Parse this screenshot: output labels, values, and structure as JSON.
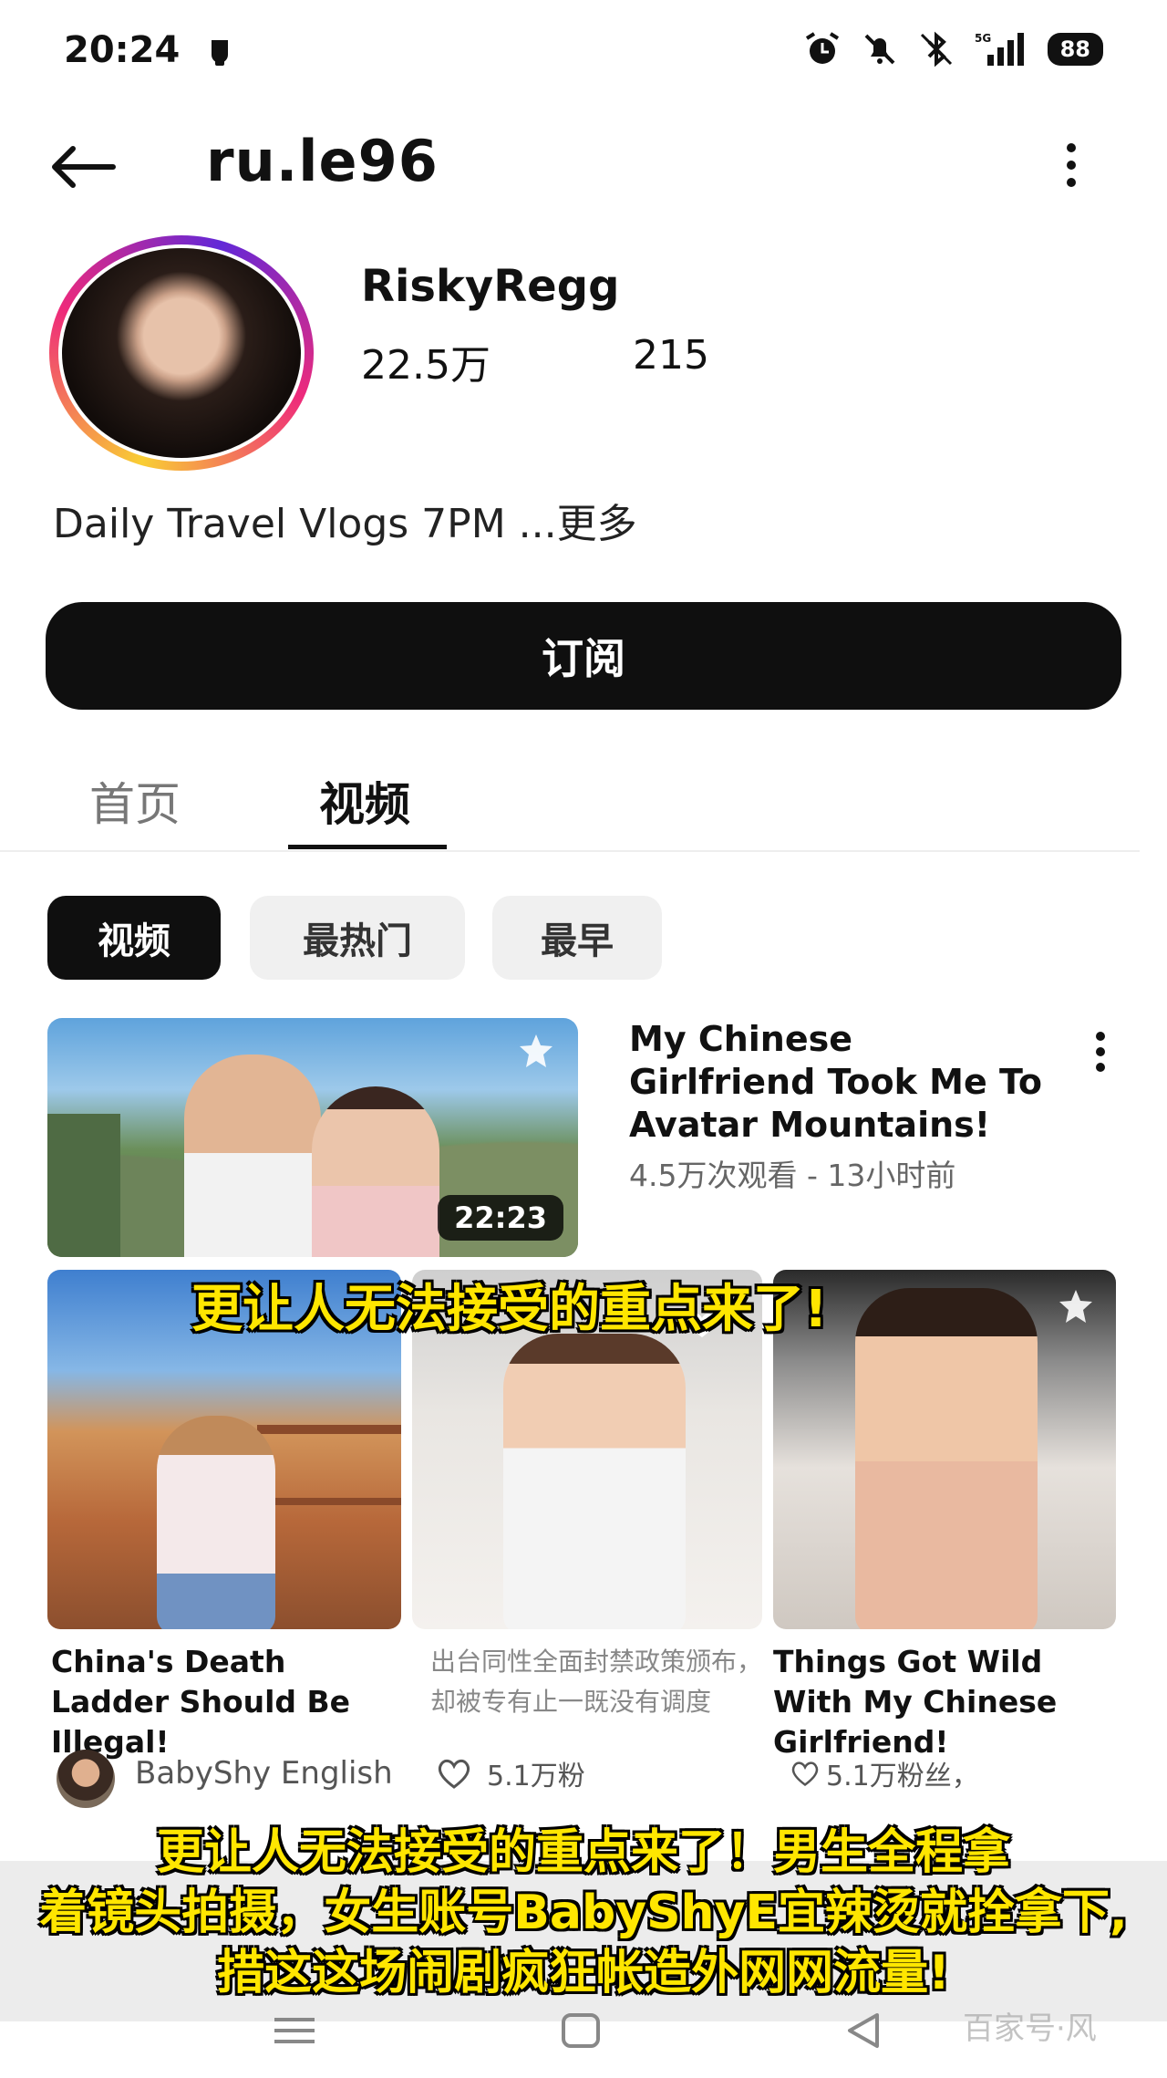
{
  "status_bar": {
    "time": "20:24",
    "battery": "88",
    "icons": [
      "notification-icon",
      "alarm-icon",
      "mute-icon",
      "bluetooth-icon",
      "signal-icon",
      "battery-icon"
    ]
  },
  "header": {
    "channel_handle": "ru.le96",
    "back_icon": "arrow-left-icon",
    "more_icon": "more-vertical-icon"
  },
  "profile": {
    "display_name": "RiskyRegg",
    "subscribers": "22.5万",
    "videos": "215",
    "bio": "Daily Travel Vlogs 7PM ...更多",
    "subscribe_label": "订阅"
  },
  "tabs": [
    {
      "label": "首页",
      "active": false
    },
    {
      "label": "视频",
      "active": true
    }
  ],
  "chips": [
    {
      "label": "视频",
      "active": true
    },
    {
      "label": "最热门",
      "active": false
    },
    {
      "label": "最早",
      "active": false
    }
  ],
  "featured_video": {
    "title": "My Chinese Girlfriend Took Me To Avatar Mountains!",
    "meta": "4.5万次观看 - 13小时前",
    "duration": "22:23"
  },
  "grid_videos": [
    {
      "title": "China's Death Ladder Should Be Illegal!"
    },
    {
      "title": "出台同性全面封禁政策颁布，却被专有止一既没有调度"
    },
    {
      "title": "Things Got Wild With My Chinese Girlfriend!"
    }
  ],
  "bottom_row": {
    "author": "BabyShy English",
    "likes_a": "5.1万粉",
    "likes_b": "5.1万粉丝，"
  },
  "captions": {
    "top": "更让人无法接受的重点来了!",
    "bottom_line1": "更让人无法接受的重点来了！男生全程拿",
    "bottom_line2": "着镜头拍摄，女生账号BabyShyE宜辣烫就拴拿下,",
    "bottom_line3": "措这这场闹剧疯狂帐造外网网流量!"
  },
  "watermark": "百家号·风",
  "colors": {
    "subscribe_bg": "#0f0f0f",
    "caption_yellow": "#ffe600",
    "avatar_ring_start": "#f9ce34",
    "avatar_ring_end": "#6228d7"
  }
}
